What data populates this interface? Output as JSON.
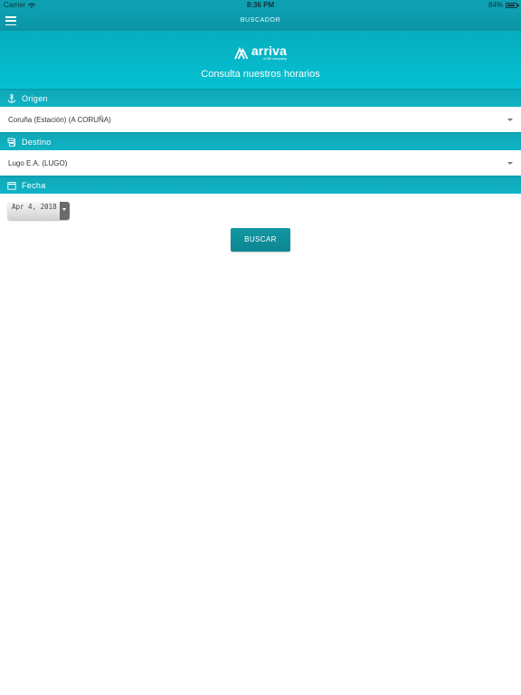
{
  "status_bar": {
    "carrier": "Carrier",
    "time": "8:36 PM",
    "battery_percent": "84%",
    "battery_level": 0.84
  },
  "nav": {
    "title": "BUSCADOR",
    "menu_icon": "hamburger-menu-icon"
  },
  "hero": {
    "logo_word": "arriva",
    "logo_sub": "a DB company",
    "subtitle": "Consulta nuestros horarios"
  },
  "origin": {
    "label": "Origen",
    "icon": "anchor-icon",
    "value": "Coruña (Estación) (A CORUÑA)"
  },
  "destination": {
    "label": "Destino",
    "icon": "bus-stop-icon",
    "value": "Lugo E.A. (LUGO)"
  },
  "date": {
    "label": "Fecha",
    "icon": "calendar-icon",
    "value": "Apr 4, 2018"
  },
  "search_button": {
    "label": "BUSCAR"
  },
  "colors": {
    "header": "#0ea0b2",
    "hero": "#04c1d2",
    "section": "#0fb3c4",
    "button": "#0c8792"
  }
}
